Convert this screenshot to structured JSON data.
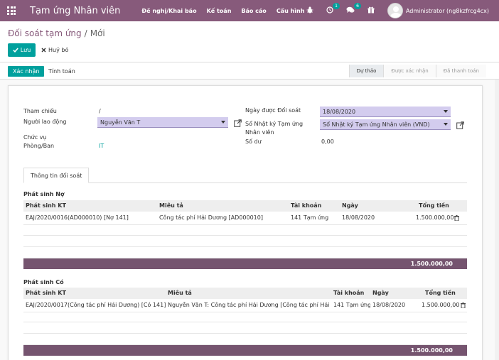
{
  "navbar": {
    "app_title": "Tạm ứng Nhân viên",
    "menu": [
      "Đề nghị/Khai báo",
      "Kế toán",
      "Báo cáo",
      "Cấu hình"
    ],
    "activity_badge": "1",
    "messages_badge": "6",
    "username": "Administrator (ng8kzfrcg4cx)"
  },
  "breadcrumb": {
    "parent": "Đối soát tạm ứng",
    "current": "Mới"
  },
  "buttons": {
    "save": "Lưu",
    "discard": "Huỷ bỏ",
    "confirm": "Xác nhận",
    "compute": "Tính toán"
  },
  "stages": [
    "Dự thảo",
    "Được xác nhận",
    "Đã thanh toán"
  ],
  "form": {
    "reference_label": "Tham chiếu",
    "reference_value": "/",
    "employee_label": "Người lao động",
    "employee_value": "Nguyễn Văn T",
    "job_label": "Chức vụ",
    "job_value": "",
    "department_label": "Phòng/Ban",
    "department_value": "IT",
    "date_label": "Ngày được Đối soát",
    "date_value": "18/08/2020",
    "journal_label_1": "Sổ Nhật ký Tạm ứng",
    "journal_label_2": "Nhân viên",
    "journal_value": "Sổ Nhật ký Tạm ứng Nhân viên (VND)",
    "balance_label": "Số dư",
    "balance_value": "0,00"
  },
  "tab": "Thông tin đối soát",
  "debit": {
    "title": "Phát sinh Nợ",
    "headers": [
      "Phát sinh KT",
      "Miêu tả",
      "Tài khoản",
      "Ngày",
      "Tổng tiền"
    ],
    "rows": [
      [
        "EAJ/2020/0016(AD000010) [Nợ 141]",
        "Công tác phí Hải Dương [AD000010]",
        "141 Tạm ứng",
        "18/08/2020",
        "1.500.000,00"
      ]
    ],
    "total": "1.500.000,00"
  },
  "credit": {
    "title": "Phát sinh Có",
    "headers": [
      "Phát sinh KT",
      "Miêu tả",
      "Tài khoản",
      "Ngày",
      "Tổng tiền"
    ],
    "rows": [
      [
        "EAJ/2020/0017(Công tác phí Hải Dương) [Có 141]",
        "Nguyễn Văn T: Công tác phí Hải Dương [Công tác phí Hải Dương]",
        "141 Tạm ứng",
        "18/08/2020",
        "1.500.000,00"
      ]
    ],
    "total": "1.500.000,00"
  },
  "colors": {
    "brand": "#875a7b",
    "accent": "#00a09d",
    "footer": "#75546f",
    "select": "#d3ccee"
  }
}
